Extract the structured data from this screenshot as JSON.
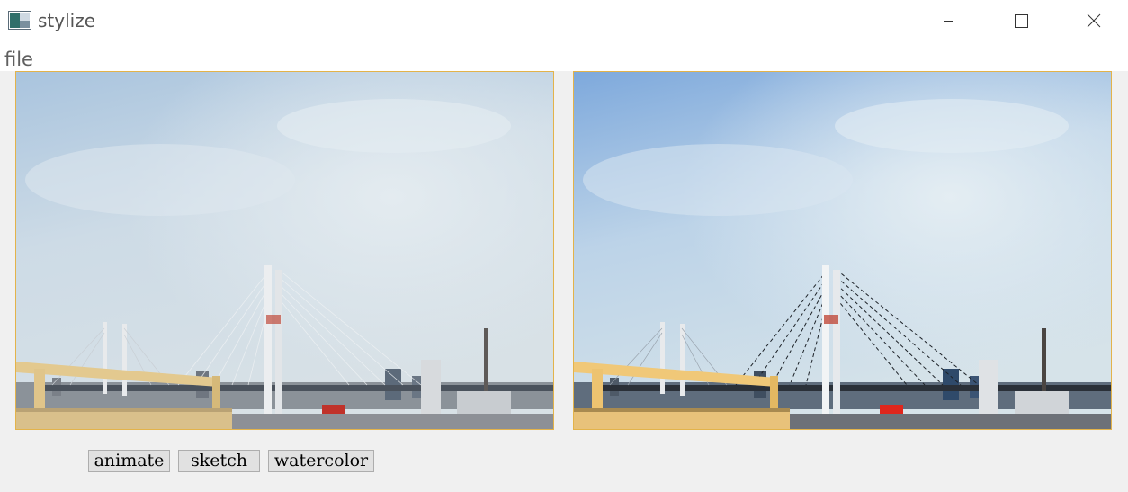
{
  "window": {
    "title": "stylize",
    "controls": [
      "minimize-icon",
      "maximize-icon",
      "close-icon"
    ]
  },
  "menu": {
    "items": [
      "file"
    ]
  },
  "panels": {
    "original_image": "bridge-photo",
    "stylized_image": "bridge-photo-stylized"
  },
  "buttons": {
    "animate": "animate",
    "sketch": "sketch",
    "watercolor": "watercolor"
  },
  "colors": {
    "panel_border": "#e3b34a",
    "background": "#f0f0f0"
  }
}
